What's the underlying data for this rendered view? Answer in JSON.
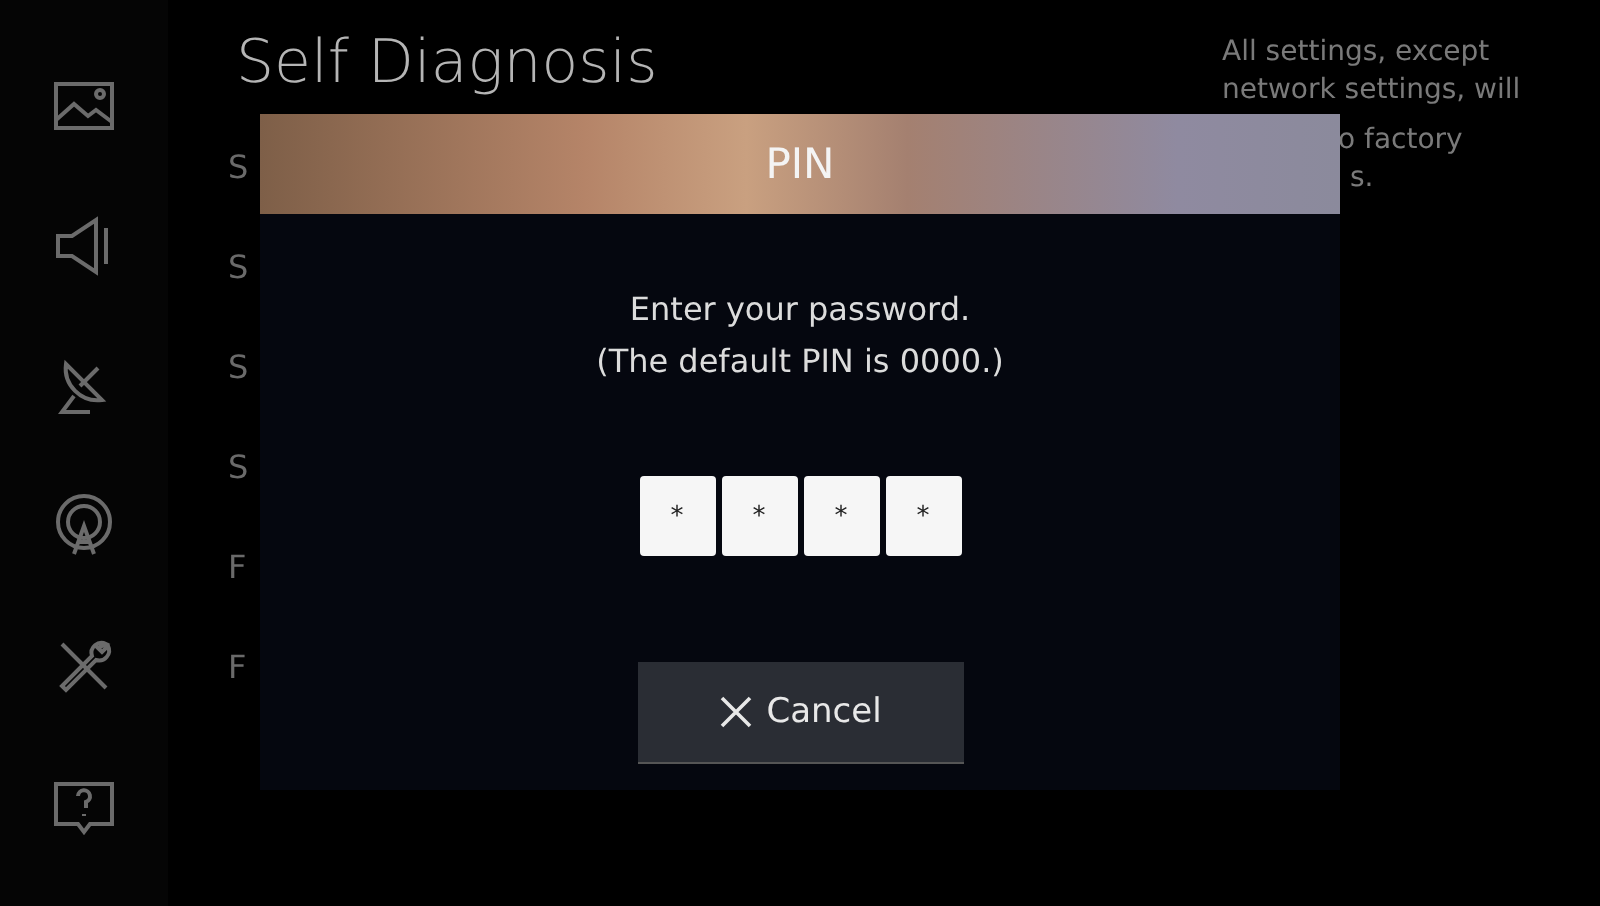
{
  "page": {
    "title": "Self Diagnosis"
  },
  "menu_items": [
    "S",
    "S",
    "S",
    "S",
    "F",
    "F"
  ],
  "description": [
    "All settings, except",
    "network settings, will",
    "o factory",
    "s."
  ],
  "dialog": {
    "title": "PIN",
    "message": [
      "Enter your password.",
      "(The default PIN is 0000.)"
    ],
    "pin_digits": [
      "*",
      "*",
      "*",
      "*"
    ],
    "buttons": [
      {
        "label": "Cancel",
        "kind": "cancel"
      }
    ]
  }
}
